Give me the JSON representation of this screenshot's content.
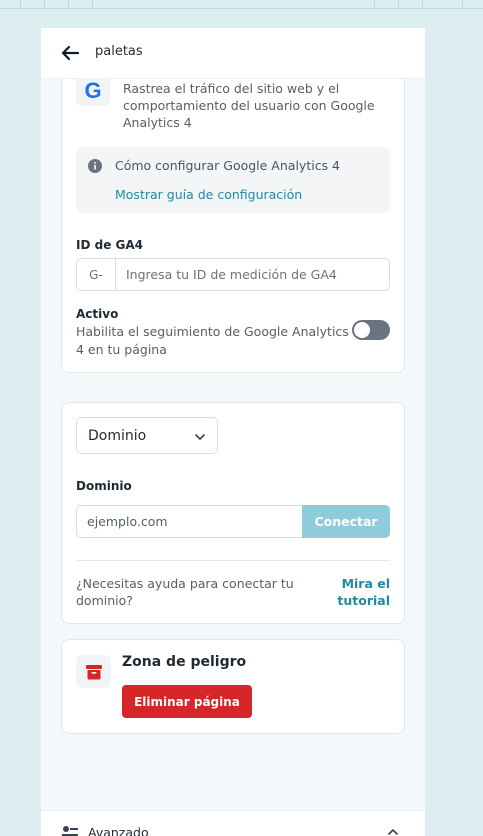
{
  "header": {
    "title": "paletas"
  },
  "google_analytics": {
    "logo_letter": "G",
    "description": "Rastrea el tráfico del sitio web y el comportamiento del usuario con Google Analytics 4",
    "info_text": "Cómo configurar Google Analytics 4",
    "info_link": "Mostrar guía de configuración",
    "ga4_label": "ID de GA4",
    "ga4_prefix": "G-",
    "ga4_placeholder": "Ingresa tu ID de medición de GA4",
    "active_label": "Activo",
    "active_description": "Habilita el seguimiento de Google Analytics 4 en tu página",
    "active_enabled": false
  },
  "domain": {
    "select_value": "Dominio",
    "field_label": "Dominio",
    "input_placeholder": "ejemplo.com",
    "connect_label": "Conectar",
    "help_text": "¿Necesitas ayuda para conectar tu dominio?",
    "tutorial_link": "Mira el tutorial"
  },
  "danger": {
    "title": "Zona de peligro",
    "delete_label": "Eliminar página"
  },
  "footer": {
    "advanced_label": "Avanzado"
  },
  "colors": {
    "background": "#dceef0",
    "accent": "#1f8ba3",
    "connect_button": "#8fcbd8",
    "danger": "#d62627",
    "toggle_off": "#6b7280"
  }
}
